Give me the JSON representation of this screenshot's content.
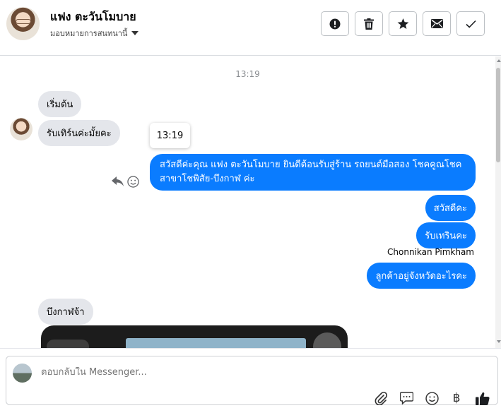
{
  "header": {
    "contact_name": "แฟง ตะวันโมบาย",
    "assign_label": "มอบหมายการสนทนานี้",
    "actions": [
      {
        "name": "mark-spam-button",
        "icon": "exclamation-icon"
      },
      {
        "name": "delete-button",
        "icon": "trash-icon"
      },
      {
        "name": "star-button",
        "icon": "star-icon"
      },
      {
        "name": "mark-unread-button",
        "icon": "envelope-icon"
      },
      {
        "name": "done-button",
        "icon": "checkmark-icon"
      }
    ]
  },
  "chat": {
    "timestamp": "13:19",
    "tooltip_time": "13:19",
    "messages": [
      {
        "direction": "in",
        "text": "เริ่มต้น"
      },
      {
        "direction": "in",
        "text": "รับเทิร์นค่ะมั้ยคะ"
      },
      {
        "direction": "out",
        "text": "สวัสดีค่ะคุณ แฟง ตะวันโมบาย ยินดีต้อนรับสู่ร้าน รถยนต์มือสอง โชคคูณโชค สาขาโชพิสัย-บึงกาฬ ค่ะ"
      },
      {
        "direction": "out",
        "text": "สวัสดีคะ"
      },
      {
        "direction": "out",
        "text": "รับเทรินคะ"
      },
      {
        "direction": "out",
        "text": "ลูกค้าอยู่จังหวัดอะไรคะ"
      },
      {
        "direction": "in",
        "text": "บึงกาฬจ้า"
      }
    ],
    "sender_name": "Chonnikan Pimkham"
  },
  "composer": {
    "placeholder": "ตอบกลับใน Messenger..."
  },
  "colors": {
    "outgoing_bubble": "#0a7cff",
    "incoming_bubble": "#e4e6eb"
  }
}
